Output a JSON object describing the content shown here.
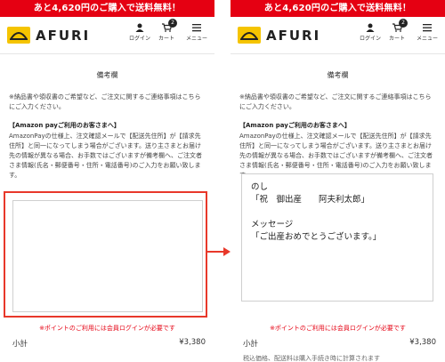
{
  "banner": "あと4,620円のご購入で送料無料！",
  "brand": "AFURI",
  "header": {
    "login": "ログイン",
    "cart": "カート",
    "menu": "メニュー",
    "cart_count": "2"
  },
  "section_title": "備考欄",
  "note": "※納品書や領収書のご希望など、ご注文に関するご連絡事項はこちらにご入力ください。",
  "amazon_title": "【Amazon payご利用のお客さまへ】",
  "amazon_body": "AmazonPayの仕様上、注文確認メールで【配送先住所】が【請求先住所】と同一になってしまう場合がございます。送り主さまとお届け先の情報が異なる場合、お手数ではございますが備考欄へ、ご注文者さま情報(氏名・郵便番号・住所・電話番号)のご入力をお願い致します。",
  "memo_lines": [
    "のし",
    "「祝　御出産　　阿夫利太郎」",
    "",
    "メッセージ",
    "「ご出産おめでとうございます。」"
  ],
  "points_note": "※ポイントのご利用には会員ログインが必要です",
  "subtotal_label": "小計",
  "subtotal_value": "¥3,380",
  "footer_note": "税込価格、配送料は購入手続き時に計算されます",
  "colors": {
    "accent": "#e50012",
    "logo": "#f5c400",
    "highlight": "#e8382a"
  }
}
